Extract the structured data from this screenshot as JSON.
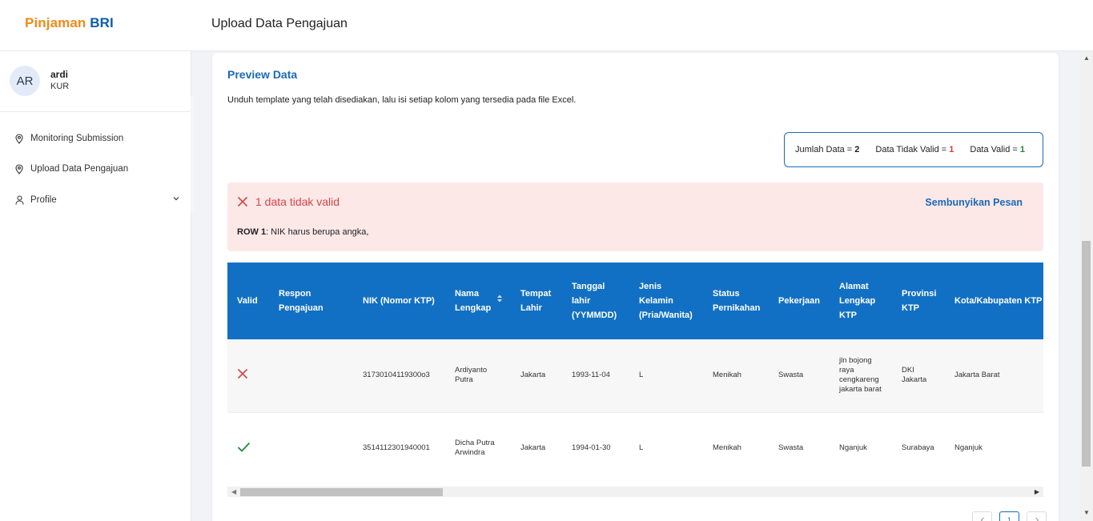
{
  "header": {
    "logo_part1": "Pinjaman",
    "logo_part2": "BRI",
    "title": "Upload Data Pengajuan"
  },
  "user": {
    "initials": "AR",
    "name": "ardi",
    "role": "KUR"
  },
  "sidebar": {
    "items": [
      {
        "label": "Monitoring Submission",
        "icon": "location-pin-icon"
      },
      {
        "label": "Upload Data Pengajuan",
        "icon": "location-pin-icon"
      },
      {
        "label": "Profile",
        "icon": "user-icon"
      }
    ]
  },
  "card": {
    "title": "Preview Data",
    "description": "Unduh template yang telah disediakan, lalu isi setiap kolom yang tersedia pada file Excel."
  },
  "summary": {
    "total_label": "Jumlah Data = ",
    "total_value": "2",
    "invalid_label": "Data Tidak Valid = ",
    "invalid_value": "1",
    "valid_label": "Data Valid = ",
    "valid_value": "1"
  },
  "alert": {
    "title": "1 data tidak valid",
    "hide_label": "Sembunyikan Pesan",
    "row_label": "ROW 1",
    "row_message": ": NIK harus berupa angka,"
  },
  "table": {
    "headers": [
      "Valid",
      "Respon Pengajuan",
      "NIK (Nomor KTP)",
      "Nama Lengkap",
      "Tempat Lahir",
      "Tanggal lahir (YYMMDD)",
      "Jenis Kelamin (Pria/Wanita)",
      "Status Pernikahan",
      "Pekerjaan",
      "Alamat Lengkap KTP",
      "Provinsi KTP",
      "Kota/Kabupaten KTP"
    ],
    "rows": [
      {
        "valid": false,
        "respon": "",
        "nik": "31730104119300o3",
        "nama": "Ardiyanto Putra",
        "tempat": "Jakarta",
        "tanggal": "1993-11-04",
        "jk": "L",
        "status": "Menikah",
        "pekerjaan": "Swasta",
        "alamat": "jln bojong raya cengkareng jakarta barat",
        "provinsi": "DKI Jakarta",
        "kota": "Jakarta Barat"
      },
      {
        "valid": true,
        "respon": "",
        "nik": "3514112301940001",
        "nama": "Dicha Putra Arwindra",
        "tempat": "Jakarta",
        "tanggal": "1994-01-30",
        "jk": "L",
        "status": "Menikah",
        "pekerjaan": "Swasta",
        "alamat": "Nganjuk",
        "provinsi": "Surabaya",
        "kota": "Nganjuk"
      }
    ]
  },
  "pagination": {
    "current_page": "1"
  },
  "colors": {
    "brand_blue": "#1a6ab7",
    "header_blue": "#1270c4",
    "brand_orange": "#f08a1c",
    "error_red": "#d84343",
    "success_green": "#1b8a3d"
  }
}
